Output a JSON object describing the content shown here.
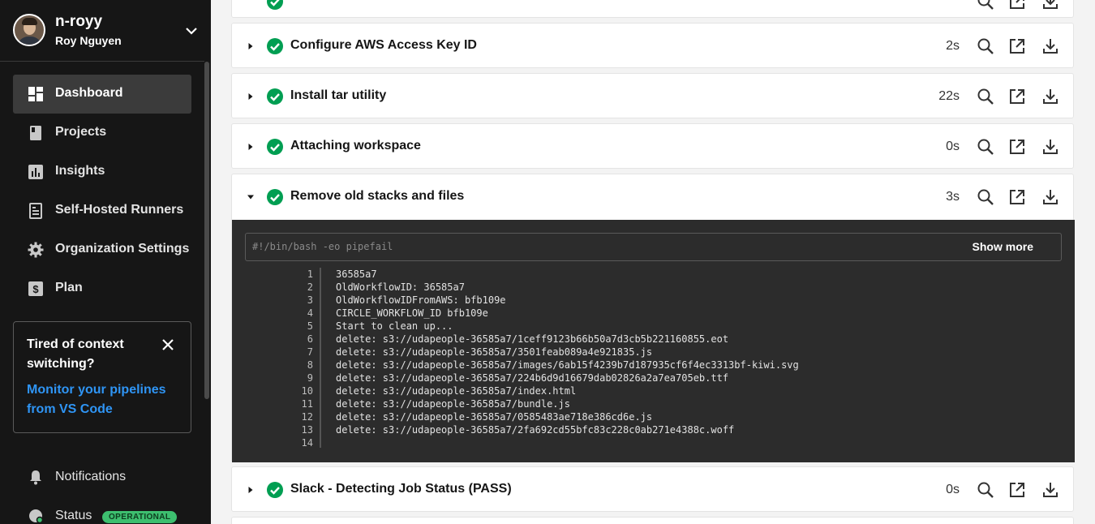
{
  "sidebar": {
    "org_name": "n-royy",
    "user_name": "Roy Nguyen",
    "nav": [
      {
        "label": "Dashboard",
        "icon": "dashboard-icon",
        "active": true
      },
      {
        "label": "Projects",
        "icon": "projects-icon"
      },
      {
        "label": "Insights",
        "icon": "insights-icon"
      },
      {
        "label": "Self-Hosted Runners",
        "icon": "runners-icon"
      },
      {
        "label": "Organization Settings",
        "icon": "gear-icon"
      },
      {
        "label": "Plan",
        "icon": "plan-icon"
      }
    ],
    "promo": {
      "title": "Tired of context switching?",
      "link": "Monitor your pipelines from VS Code"
    },
    "notifications_label": "Notifications",
    "status_label": "Status",
    "status_badge": "OPERATIONAL"
  },
  "steps": [
    {
      "title": "Configure AWS Access Key ID",
      "duration": "2s",
      "expanded": false
    },
    {
      "title": "Install tar utility",
      "duration": "22s",
      "expanded": false
    },
    {
      "title": "Attaching workspace",
      "duration": "0s",
      "expanded": false
    },
    {
      "title": "Remove old stacks and files",
      "duration": "3s",
      "expanded": true
    },
    {
      "title": "Slack - Detecting Job Status (PASS)",
      "duration": "0s",
      "expanded": false
    }
  ],
  "output": {
    "command": "#!/bin/bash -eo pipefail",
    "show_more": "Show more",
    "lines": [
      "36585a7",
      "OldWorkflowID: 36585a7",
      "OldWorkflowIDFromAWS: bfb109e",
      "CIRCLE_WORKFLOW_ID bfb109e",
      "Start to clean up...",
      "delete: s3://udapeople-36585a7/1ceff9123b66b50a7d3cb5b221160855.eot",
      "delete: s3://udapeople-36585a7/3501feab089a4e921835.js",
      "delete: s3://udapeople-36585a7/images/6ab15f4239b7d187935cf6f4ec3313bf-kiwi.svg",
      "delete: s3://udapeople-36585a7/224b6d9d16679dab02826a2a7ea705eb.ttf",
      "delete: s3://udapeople-36585a7/index.html",
      "delete: s3://udapeople-36585a7/bundle.js",
      "delete: s3://udapeople-36585a7/0585483ae718e386cd6e.js",
      "delete: s3://udapeople-36585a7/2fa692cd55bfc83c228c0ab271e4388c.woff",
      ""
    ],
    "line_numbers": [
      "1",
      "2",
      "3",
      "4",
      "5",
      "6",
      "7",
      "8",
      "9",
      "10",
      "11",
      "12",
      "13",
      "14"
    ]
  },
  "colors": {
    "sidebar_bg": "#161616",
    "success": "#009e52",
    "link": "#2f95f5",
    "log_bg": "#2c2c2c"
  }
}
